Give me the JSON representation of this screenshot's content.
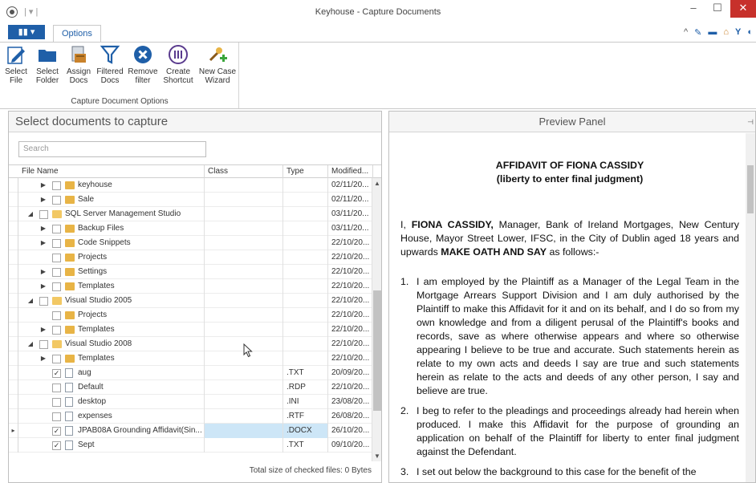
{
  "window": {
    "title": "Keyhouse - Capture Documents",
    "quick_access_sep": "| ▾ |",
    "minimize": "–",
    "maximize": "☐",
    "close": "✕"
  },
  "ribbon": {
    "file_tab_label": "▮▮ ▾",
    "options_tab_label": "Options",
    "right_icons": [
      "^",
      "✎",
      "▬",
      "⌂",
      "Y",
      "◐"
    ],
    "group_label": "Capture Document Options",
    "buttons": [
      {
        "id": "select-file",
        "line1": "Select",
        "line2": "File",
        "icon": "pencil-page-icon"
      },
      {
        "id": "select-folder",
        "line1": "Select",
        "line2": "Folder",
        "icon": "folder-icon"
      },
      {
        "id": "assign-docs",
        "line1": "Assign",
        "line2": "Docs",
        "icon": "assign-docs-icon"
      },
      {
        "id": "filtered-docs",
        "line1": "Filtered",
        "line2": "Docs",
        "icon": "funnel-icon"
      },
      {
        "id": "remove-filter",
        "line1": "Remove",
        "line2": "filter",
        "icon": "remove-x-icon"
      },
      {
        "id": "create-shortcut",
        "line1": "Create",
        "line2": "Shortcut",
        "icon": "shortcut-icon"
      },
      {
        "id": "new-case-wizard",
        "line1": "New Case",
        "line2": "Wizard",
        "icon": "wizard-icon"
      }
    ],
    "colors": {
      "accent": "#1f5fa8",
      "close": "#c7312b"
    }
  },
  "left_panel": {
    "title": "Select documents to capture",
    "search_placeholder": "Search",
    "columns": [
      "File Name",
      "Class",
      "Type",
      "Modified..."
    ],
    "total_text": "Total size of checked files: 0 Bytes",
    "rows": [
      {
        "indent": 1,
        "expander": "▶",
        "checked": false,
        "kind": "folder",
        "name": "keyhouse",
        "class": "",
        "type": "",
        "modified": "02/11/20..."
      },
      {
        "indent": 1,
        "expander": "▶",
        "checked": false,
        "kind": "folder",
        "name": "Sale",
        "class": "",
        "type": "",
        "modified": "02/11/20..."
      },
      {
        "indent": 0,
        "expander": "◢",
        "checked": false,
        "kind": "folder-open",
        "name": "SQL Server Management Studio",
        "class": "",
        "type": "",
        "modified": "03/11/20..."
      },
      {
        "indent": 1,
        "expander": "▶",
        "checked": false,
        "kind": "folder",
        "name": "Backup Files",
        "class": "",
        "type": "",
        "modified": "03/11/20..."
      },
      {
        "indent": 1,
        "expander": "▶",
        "checked": false,
        "kind": "folder",
        "name": "Code Snippets",
        "class": "",
        "type": "",
        "modified": "22/10/20..."
      },
      {
        "indent": 1,
        "expander": "",
        "checked": false,
        "kind": "folder",
        "name": "Projects",
        "class": "",
        "type": "",
        "modified": "22/10/20..."
      },
      {
        "indent": 1,
        "expander": "▶",
        "checked": false,
        "kind": "folder",
        "name": "Settings",
        "class": "",
        "type": "",
        "modified": "22/10/20..."
      },
      {
        "indent": 1,
        "expander": "▶",
        "checked": false,
        "kind": "folder",
        "name": "Templates",
        "class": "",
        "type": "",
        "modified": "22/10/20..."
      },
      {
        "indent": 0,
        "expander": "◢",
        "checked": false,
        "kind": "folder-open",
        "name": "Visual Studio 2005",
        "class": "",
        "type": "",
        "modified": "22/10/20..."
      },
      {
        "indent": 1,
        "expander": "",
        "checked": false,
        "kind": "folder",
        "name": "Projects",
        "class": "",
        "type": "",
        "modified": "22/10/20..."
      },
      {
        "indent": 1,
        "expander": "▶",
        "checked": false,
        "kind": "folder",
        "name": "Templates",
        "class": "",
        "type": "",
        "modified": "22/10/20..."
      },
      {
        "indent": 0,
        "expander": "◢",
        "checked": false,
        "kind": "folder-open",
        "name": "Visual Studio 2008",
        "class": "",
        "type": "",
        "modified": "22/10/20..."
      },
      {
        "indent": 1,
        "expander": "▶",
        "checked": false,
        "kind": "folder",
        "name": "Templates",
        "class": "",
        "type": "",
        "modified": "22/10/20..."
      },
      {
        "indent": 1,
        "expander": "",
        "checked": true,
        "kind": "file",
        "name": "aug",
        "class": "",
        "type": ".TXT",
        "modified": "20/09/20..."
      },
      {
        "indent": 1,
        "expander": "",
        "checked": false,
        "kind": "file",
        "name": "Default",
        "class": "",
        "type": ".RDP",
        "modified": "22/10/20..."
      },
      {
        "indent": 1,
        "expander": "",
        "checked": false,
        "kind": "file",
        "name": "desktop",
        "class": "",
        "type": ".INI",
        "modified": "23/08/20..."
      },
      {
        "indent": 1,
        "expander": "",
        "checked": false,
        "kind": "file",
        "name": "expenses",
        "class": "",
        "type": ".RTF",
        "modified": "26/08/20..."
      },
      {
        "indent": 1,
        "expander": "",
        "checked": true,
        "kind": "file",
        "name": "JPAB08A Grounding Affidavit(Sin...",
        "class": "",
        "type": ".DOCX",
        "modified": "26/10/20...",
        "selected": true
      },
      {
        "indent": 1,
        "expander": "",
        "checked": true,
        "kind": "file",
        "name": "Sept",
        "class": "",
        "type": ".TXT",
        "modified": "09/10/20..."
      }
    ]
  },
  "preview": {
    "title": "Preview Panel",
    "pin": "⊣",
    "doc_title_1": "AFFIDAVIT OF FIONA CASSIDY",
    "doc_title_2": "(liberty to enter final judgment)",
    "intro_1": "I, ",
    "intro_name": "FIONA CASSIDY,",
    "intro_2": " Manager, Bank of Ireland Mortgages, New Century House, Mayor Street Lower, IFSC, in the City of Dublin aged 18 years and upwards ",
    "intro_oath": "MAKE OATH AND SAY",
    "intro_3": " as follows:-",
    "items": [
      {
        "num": "1.",
        "text": "I am employed by the Plaintiff as a Manager of the Legal Team in the Mortgage Arrears Support Division and I am duly authorised by the Plaintiff to make this Affidavit for it and on its behalf, and I do so from my own knowledge and from a diligent perusal of the Plaintiff's books and records, save as where otherwise appears and where so otherwise appearing I believe to be true and accurate. Such statements herein as relate to my own acts and deeds I say are true and such statements herein as relate to the acts and deeds of any other person, I say and believe are true."
      },
      {
        "num": "2.",
        "text": "I beg to refer to the pleadings and proceedings already had herein when produced. I make this Affidavit for the purpose of grounding an application on behalf of the Plaintiff for liberty to enter final judgment against the Defendant."
      },
      {
        "num": "3.",
        "text": "I set out below the background to this case for the benefit of the"
      }
    ]
  }
}
